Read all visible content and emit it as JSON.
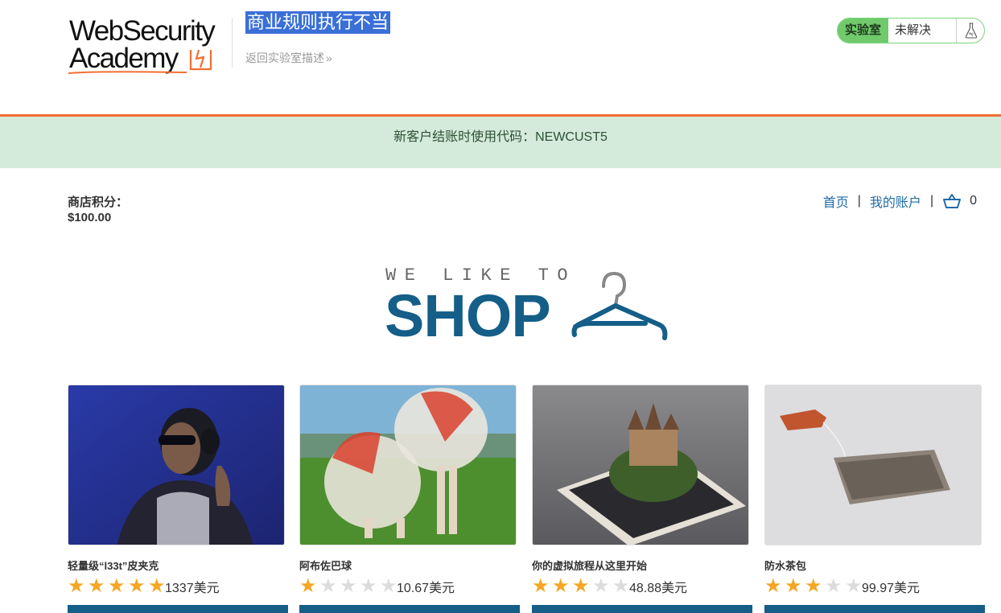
{
  "header": {
    "logo_line1": "WebSecurity",
    "logo_line2": "Academy",
    "lab_title": "商业规则执行不当",
    "back_link": "返回实验室描述",
    "back_chevron": "»",
    "status_tag": "实验室",
    "status_value": "未解决"
  },
  "notice": "新客户结账时使用代码：NEWCUST5",
  "store": {
    "credit_label": "商店积分：",
    "credit_value": "$100.00",
    "nav_home": "首页",
    "nav_separator": "|",
    "nav_account": "我的账户",
    "cart_count": "0"
  },
  "banner": {
    "we_like_to": "WE LIKE TO",
    "shop": "SHOP"
  },
  "products": [
    {
      "name": "轻量级“l33t”皮夹克",
      "rating": 5,
      "price": "1337美元"
    },
    {
      "name": "阿布佐巴球",
      "rating": 1,
      "price": "10.67美元"
    },
    {
      "name": "你的虚拟旅程从这里开始",
      "rating": 3,
      "price": "48.88美元"
    },
    {
      "name": "防水茶包",
      "rating": 3,
      "price": "99.97美元"
    }
  ],
  "colors": {
    "accent": "#145e88",
    "orange": "#f26f33",
    "notice_bg": "#d4eadb",
    "status_green": "#70c96b",
    "link": "#1f6ba6",
    "star": "#f5a623"
  }
}
